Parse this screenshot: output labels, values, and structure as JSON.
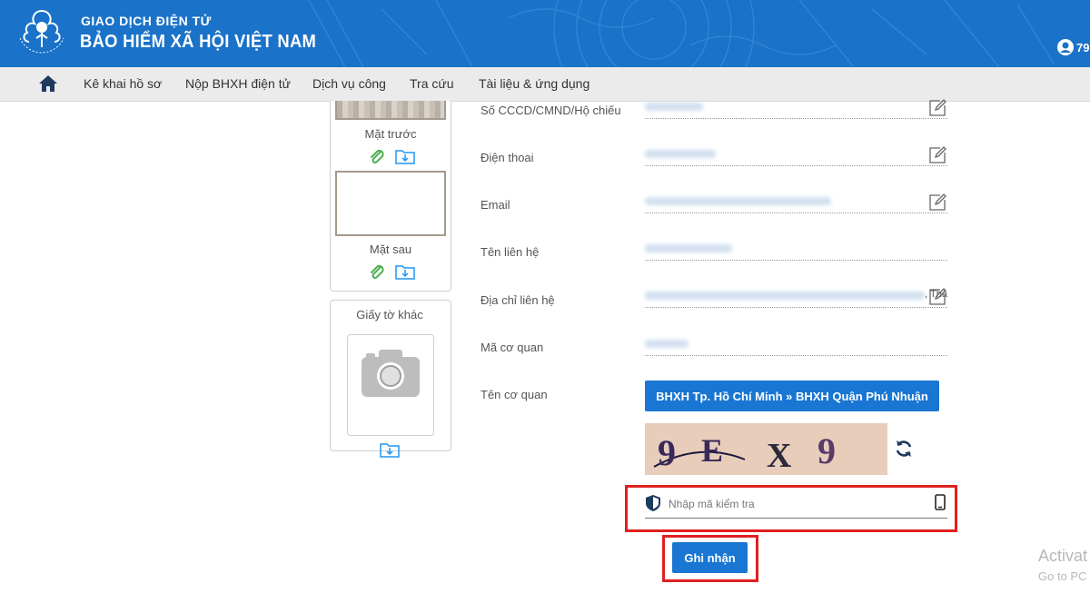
{
  "header": {
    "brand_top": "GIAO DỊCH ĐIỆN TỬ",
    "brand_main": "BẢO HIỂM XÃ HỘI VIỆT NAM",
    "user_text": "79",
    "bg_color": "#1a72c9"
  },
  "nav": {
    "home_icon": "home-icon",
    "items": [
      {
        "label": "Kê khai hồ sơ"
      },
      {
        "label": "Nộp BHXH điện tử"
      },
      {
        "label": "Dịch vụ công"
      },
      {
        "label": "Tra cứu"
      },
      {
        "label": "Tài liệu & ứng dụng"
      }
    ]
  },
  "documents": {
    "front_caption": "Mặt trước",
    "back_caption": "Mặt sau",
    "other_caption": "Giấy tờ khác"
  },
  "form": {
    "labels": {
      "id_number": "Số CCCD/CMND/Hộ chiếu",
      "phone": "Điện thoai",
      "email": "Email",
      "contact_name": "Tên liên hệ",
      "contact_address": "Địa chỉ liên hệ",
      "agency_code": "Mã cơ quan",
      "agency_name": "Tên cơ quan"
    },
    "address_tail": ", Thà",
    "agency_button": "BHXH Tp. Hồ Chí Minh » BHXH Quận Phú Nhuận",
    "captcha_text": "9EX9",
    "captcha_placeholder": "Nhập mã kiểm tra",
    "submit_label": "Ghi nhận",
    "accent_color": "#1976d2",
    "highlight_color": "#e02020"
  },
  "watermark": {
    "line1": "Activat",
    "line2": "Go to PC"
  }
}
